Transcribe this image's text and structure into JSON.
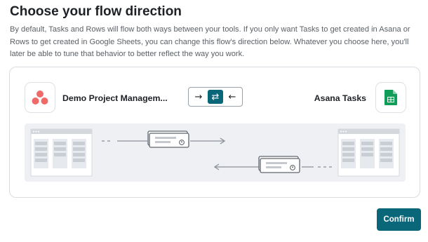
{
  "page": {
    "title": "Choose your flow direction",
    "description": "By default, Tasks and Rows will flow both ways between your tools. If you only want Tasks to get created in Asana or Rows to get created in Google Sheets, you can change this flow's direction below. Whatever you choose here, you'll later be able to tune that behavior to better reflect the way you work."
  },
  "left_app": {
    "name": "Demo Project Managem...",
    "icon": "asana-logo-icon",
    "brand_color": "#f06a6a"
  },
  "right_app": {
    "name": "Asana Tasks",
    "icon": "google-sheets-icon",
    "brand_color": "#0f9d58"
  },
  "direction": {
    "options": [
      {
        "glyph": "→",
        "name": "left-to-right"
      },
      {
        "glyph": "⇄",
        "name": "two-way"
      },
      {
        "glyph": "←",
        "name": "right-to-left"
      }
    ],
    "selected": "two-way",
    "accent": "#0a6679"
  },
  "actions": {
    "confirm_label": "Confirm"
  }
}
